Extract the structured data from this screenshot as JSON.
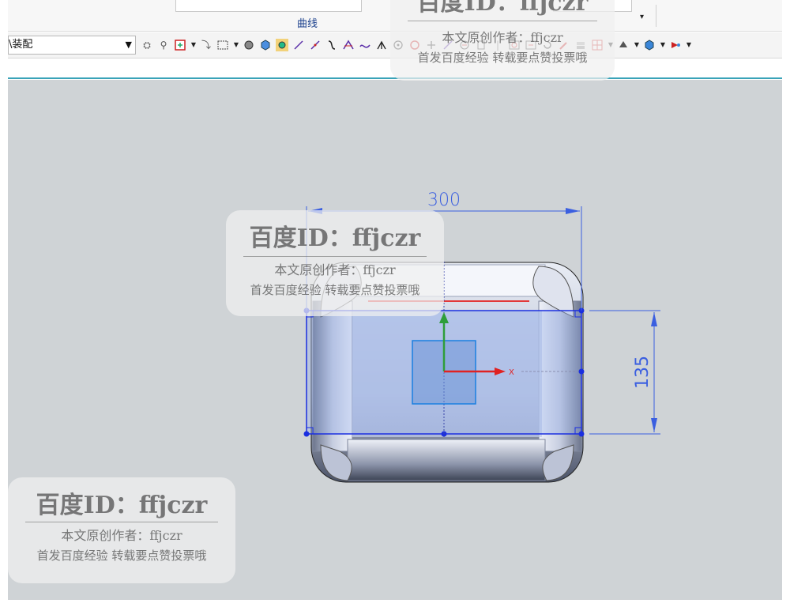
{
  "ribbon": {
    "group_label": "曲线",
    "dropdown_arrow": "▾"
  },
  "toolbar": {
    "selection_filter": {
      "value": "\\装配",
      "arrow": "▼"
    }
  },
  "viewport": {
    "dimension_width": "300",
    "dimension_height": "135",
    "x_axis_label": "X",
    "colors": {
      "background": "#cfd3d6",
      "sketch_line": "#1a2ee0",
      "dimension_line": "#3b5fe0",
      "y_axis": "#2e9e3a",
      "x_axis": "#e02222",
      "sketch_plane": "#5b9bd5"
    }
  },
  "watermark": {
    "line1": "百度ID：ffjczr",
    "line2": "本文原创作者：ffjczr",
    "line3": "首发百度经验 转载要点赞投票哦"
  }
}
